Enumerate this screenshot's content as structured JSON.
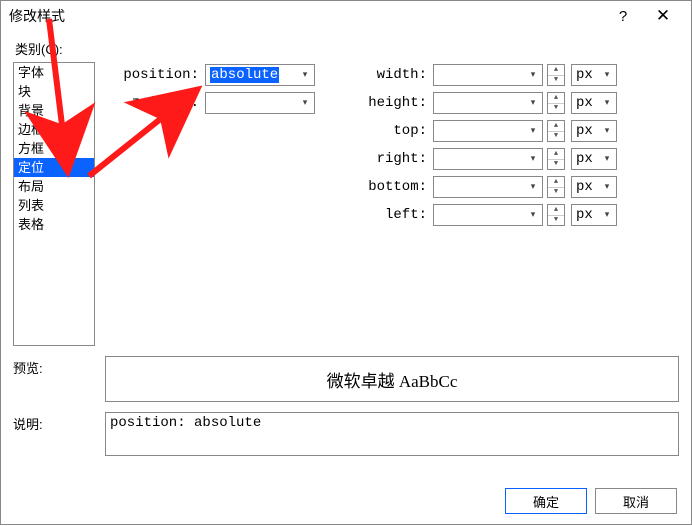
{
  "title": "修改样式",
  "categoryLabel": "类别(C):",
  "categories": {
    "items": [
      {
        "label": "字体"
      },
      {
        "label": "块"
      },
      {
        "label": "背景"
      },
      {
        "label": "边框"
      },
      {
        "label": "方框"
      },
      {
        "label": "定位"
      },
      {
        "label": "布局"
      },
      {
        "label": "列表"
      },
      {
        "label": "表格"
      }
    ],
    "selectedIndex": 5
  },
  "fields": {
    "position": {
      "label": "position:",
      "value": "absolute"
    },
    "zindex": {
      "label": "z-index:",
      "value": ""
    },
    "width": {
      "label": "width:",
      "value": "",
      "unit": "px"
    },
    "height": {
      "label": "height:",
      "value": "",
      "unit": "px"
    },
    "top": {
      "label": "top:",
      "value": "",
      "unit": "px"
    },
    "right": {
      "label": "right:",
      "value": "",
      "unit": "px"
    },
    "bottom": {
      "label": "bottom:",
      "value": "",
      "unit": "px"
    },
    "left": {
      "label": "left:",
      "value": "",
      "unit": "px"
    }
  },
  "preview": {
    "label": "预览:",
    "sample": "微软卓越 AaBbCc"
  },
  "description": {
    "label": "说明:",
    "text": "position: absolute"
  },
  "buttons": {
    "ok": "确定",
    "cancel": "取消"
  }
}
